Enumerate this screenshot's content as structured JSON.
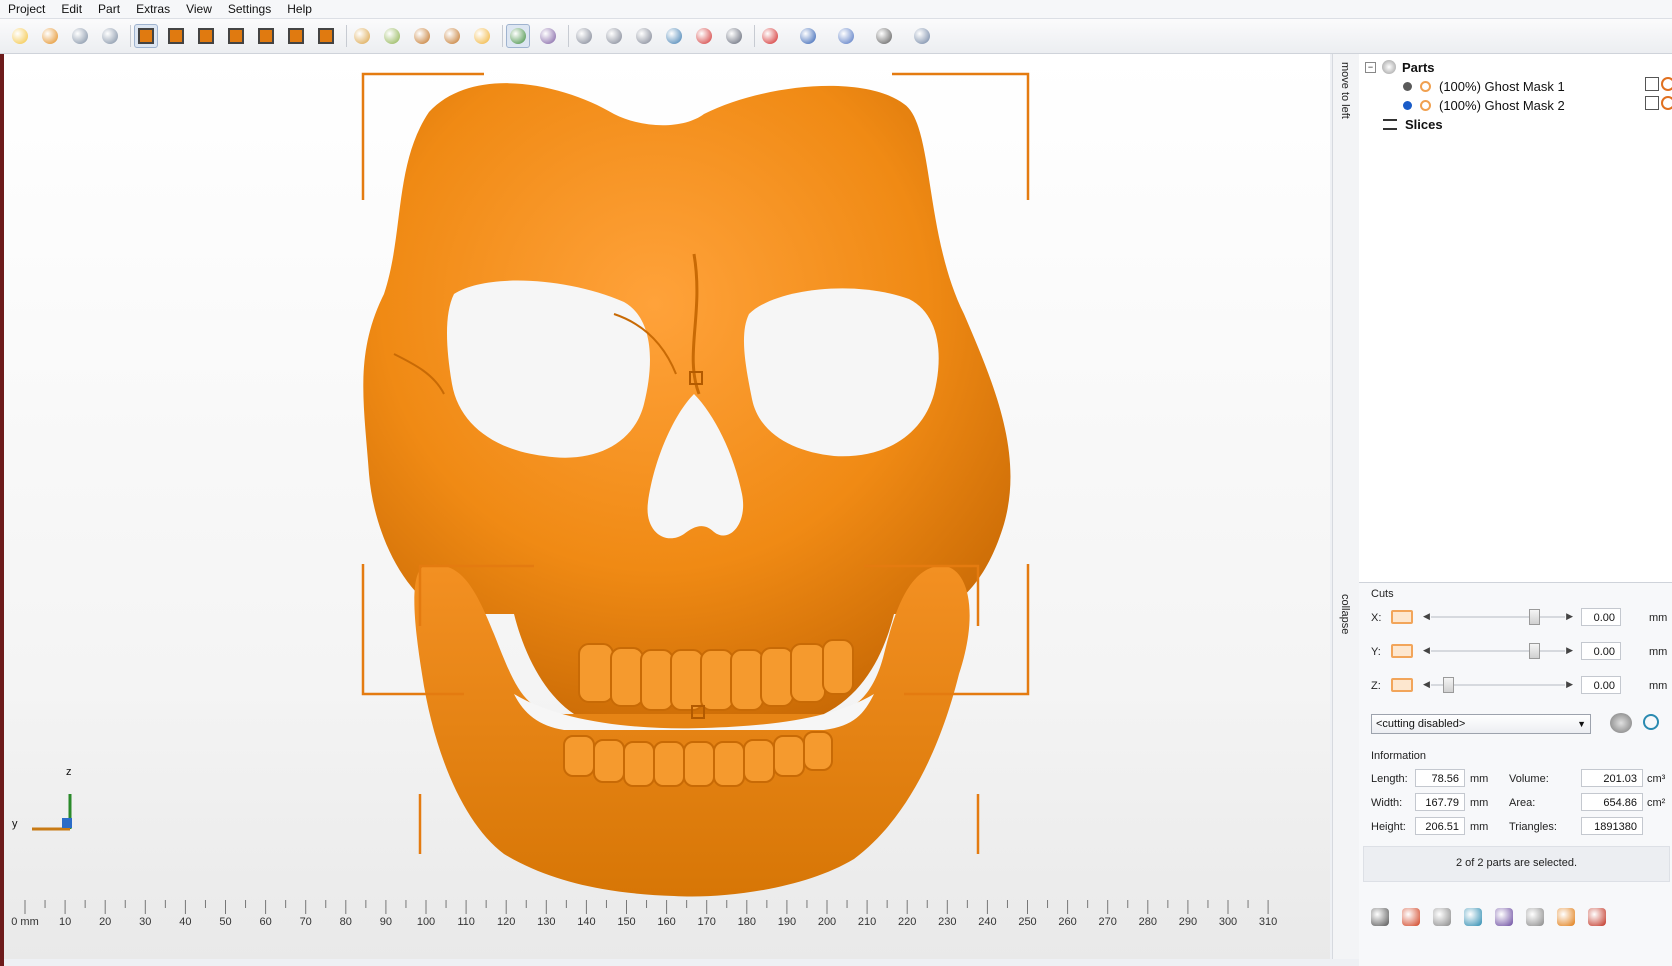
{
  "menu": [
    "Project",
    "Edit",
    "Part",
    "Extras",
    "View",
    "Settings",
    "Help"
  ],
  "toolbar": {
    "icons": [
      "open-file-icon",
      "load-parts-icon",
      "export-icon",
      "add-part-icon",
      "view-front-icon",
      "view-back-icon",
      "view-left-icon",
      "view-right-icon",
      "view-top-icon",
      "view-bottom-icon",
      "view-iso-icon",
      "shading-icon",
      "texture-icon",
      "zoom-fit-icon",
      "zoom-selection-icon",
      "zoom-icon",
      "select-cursor-icon",
      "axis-transform-icon",
      "place-on-platform-icon",
      "rotate-icon",
      "scale-icon",
      "mesh-icon",
      "color-icon",
      "view-mode-icon",
      "repair-icon",
      "analysis-icon",
      "measure-icon",
      "text-label-icon",
      "person-icon"
    ]
  },
  "sidebar": {
    "strip_top": "move to left",
    "strip_bottom": "collapse",
    "tree": {
      "root_label": "Parts",
      "items": [
        {
          "label": "(100%) Ghost Mask 1",
          "dot_color": "#5a5a5a"
        },
        {
          "label": "(100%) Ghost Mask 2",
          "dot_color": "#1a5cc8"
        }
      ],
      "slices_label": "Slices"
    },
    "cuts": {
      "title": "Cuts",
      "rows": [
        {
          "axis": "X:",
          "value": "0.00",
          "unit": "mm",
          "level": 0.8
        },
        {
          "axis": "Y:",
          "value": "0.00",
          "unit": "mm",
          "level": 0.8
        },
        {
          "axis": "Z:",
          "value": "0.00",
          "unit": "mm",
          "level": 0.1
        }
      ],
      "mode": "<cutting disabled>"
    },
    "info": {
      "title": "Information",
      "length_label": "Length:",
      "length": "78.56",
      "length_unit": "mm",
      "width_label": "Width:",
      "width": "167.79",
      "width_unit": "mm",
      "height_label": "Height:",
      "height": "206.51",
      "height_unit": "mm",
      "volume_label": "Volume:",
      "volume": "201.03",
      "volume_unit": "cm³",
      "area_label": "Area:",
      "area": "654.86",
      "area_unit": "cm²",
      "triangles_label": "Triangles:",
      "triangles": "1891380"
    },
    "status": "2 of 2 parts are selected.",
    "bottom_icons": [
      "snap-icon",
      "warning-icon",
      "link-icon",
      "refresh-icon",
      "book-icon",
      "sphere-icon",
      "frame-icon",
      "grid-icon"
    ]
  },
  "viewport": {
    "axis_z": "z",
    "axis_y": "y",
    "ruler": [
      "0 mm",
      "10",
      "20",
      "30",
      "40",
      "50",
      "60",
      "70",
      "80",
      "90",
      "100",
      "110",
      "120",
      "130",
      "140",
      "150",
      "160",
      "170",
      "180",
      "190",
      "200",
      "210",
      "220",
      "230",
      "240",
      "250",
      "260",
      "270",
      "280",
      "290",
      "300",
      "310"
    ],
    "model_color": "#f08a14"
  }
}
